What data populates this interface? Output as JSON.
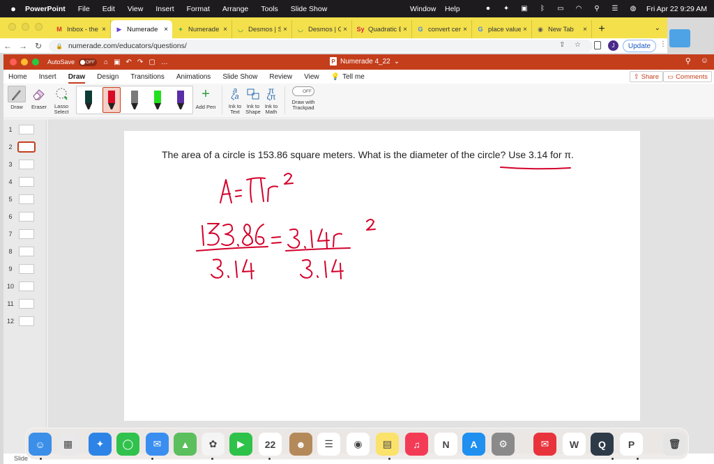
{
  "menubar": {
    "app": "PowerPoint",
    "items": [
      "File",
      "Edit",
      "View",
      "Insert",
      "Format",
      "Arrange",
      "Tools",
      "Slide Show",
      "Window",
      "Help"
    ],
    "datetime": "Fri Apr 22  9:29 AM"
  },
  "browser": {
    "tabs": [
      {
        "label": "Inbox - the",
        "icon": "gmail-icon",
        "fav": "M",
        "color": "#d93025",
        "active": false
      },
      {
        "label": "Numerade",
        "icon": "numerade-icon",
        "fav": "▶",
        "color": "#6a3fd1",
        "active": true
      },
      {
        "label": "Numerade p",
        "icon": "sheets-icon",
        "fav": "+",
        "color": "#0f9d58",
        "active": false
      },
      {
        "label": "Desmos | Sc",
        "icon": "desmos-icon",
        "fav": "◡",
        "color": "#2f8a3b",
        "active": false
      },
      {
        "label": "Desmos | Gr",
        "icon": "desmos-icon",
        "fav": "◡",
        "color": "#2f8a3b",
        "active": false
      },
      {
        "label": "Quadratic E",
        "icon": "symbolab-icon",
        "fav": "Sy",
        "color": "#d7263d",
        "active": false
      },
      {
        "label": "convert cer",
        "icon": "google-icon",
        "fav": "G",
        "color": "#4285f4",
        "active": false
      },
      {
        "label": "place value",
        "icon": "google-icon",
        "fav": "G",
        "color": "#4285f4",
        "active": false
      },
      {
        "label": "New Tab",
        "icon": "chrome-icon",
        "fav": "◉",
        "color": "#555555",
        "active": false
      }
    ],
    "url": "numerade.com/educators/questions/",
    "avatar": "J",
    "update_label": "Update"
  },
  "ppt": {
    "autosave_label": "AutoSave",
    "autosave_state": "OFF",
    "doc_title": "Numerade 4_22",
    "tabs": [
      "Home",
      "Insert",
      "Draw",
      "Design",
      "Transitions",
      "Animations",
      "Slide Show",
      "Review",
      "View",
      "Tell me"
    ],
    "active_tab": "Draw",
    "share_label": "Share",
    "comments_label": "Comments",
    "tools": {
      "draw": "Draw",
      "eraser": "Eraser",
      "lasso": "Lasso\nSelect",
      "add_pen": "Add Pen",
      "ink_to_text": "Ink to\nText",
      "ink_to_shape": "Ink to\nShape",
      "ink_to_math": "Ink to\nMath",
      "trackpad": "Draw with\nTrackpad",
      "trackpad_state": "OFF"
    },
    "pens": [
      {
        "color": "#0d3b36",
        "selected": false
      },
      {
        "color": "#d80a26",
        "selected": true
      },
      {
        "color": "#7a7a7a",
        "selected": false
      },
      {
        "color": "#22e01f",
        "selected": false
      },
      {
        "color": "#5a2ea6",
        "selected": false
      }
    ],
    "slides": [
      "1",
      "2",
      "3",
      "4",
      "5",
      "6",
      "7",
      "8",
      "9",
      "10",
      "11",
      "12"
    ],
    "selected_slide": "2",
    "slide": {
      "question": "The area of a circle is 153.86 square meters. What is the diameter of the circle? Use 3.14 for π.",
      "ink_color": "#d4002a"
    }
  },
  "dock": {
    "apps": [
      {
        "name": "finder-icon",
        "color": "#3b8fe8",
        "glyph": "☺"
      },
      {
        "name": "launchpad-icon",
        "color": "#e9e9e9",
        "glyph": "▦"
      },
      {
        "name": "safari-icon",
        "color": "#2d84e6",
        "glyph": "✦"
      },
      {
        "name": "messages-icon",
        "color": "#30c24c",
        "glyph": "◯"
      },
      {
        "name": "mail-icon",
        "color": "#3a8ef0",
        "glyph": "✉"
      },
      {
        "name": "maps-icon",
        "color": "#5bbf5e",
        "glyph": "▲"
      },
      {
        "name": "photos-icon",
        "color": "#f4f4f4",
        "glyph": "✿"
      },
      {
        "name": "facetime-icon",
        "color": "#2ec24a",
        "glyph": "▶"
      },
      {
        "name": "calendar-icon",
        "color": "#ffffff",
        "glyph": "22"
      },
      {
        "name": "contacts-icon",
        "color": "#b58a5a",
        "glyph": "☻"
      },
      {
        "name": "reminders-icon",
        "color": "#ffffff",
        "glyph": "☰"
      },
      {
        "name": "chrome-icon",
        "color": "#ffffff",
        "glyph": "◉"
      },
      {
        "name": "notes-icon",
        "color": "#fbe26a",
        "glyph": "▤"
      },
      {
        "name": "music-icon",
        "color": "#f43b55",
        "glyph": "♫"
      },
      {
        "name": "news-icon",
        "color": "#ffffff",
        "glyph": "N"
      },
      {
        "name": "app-store-icon",
        "color": "#1f8ff0",
        "glyph": "A"
      },
      {
        "name": "system-preferences-icon",
        "color": "#8a8a8a",
        "glyph": "⚙"
      },
      {
        "name": "airmail-icon",
        "color": "#e8333c",
        "glyph": "✉"
      },
      {
        "name": "word-icon",
        "color": "#ffffff",
        "glyph": "W"
      },
      {
        "name": "quicktime-icon",
        "color": "#2d3a48",
        "glyph": "Q"
      },
      {
        "name": "powerpoint-icon",
        "color": "#ffffff",
        "glyph": "P"
      },
      {
        "name": "trash-icon",
        "color": "#e5e5e5",
        "glyph": "🗑"
      }
    ],
    "calendar_month": "APR"
  },
  "status_left": "Slide"
}
